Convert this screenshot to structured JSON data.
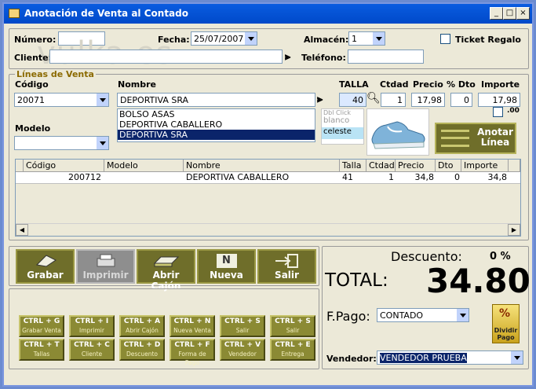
{
  "window": {
    "title": "Anotación de Venta al Contado"
  },
  "header": {
    "numero_label": "Número:",
    "numero_value": "",
    "fecha_label": "Fecha:",
    "fecha_value": "25/07/2007",
    "almacen_label": "Almacén:",
    "almacen_value": "1",
    "ticket_label": "Ticket Regalo",
    "cliente_label": "Cliente:",
    "cliente_value": "",
    "telefono_label": "Teléfono:",
    "telefono_value": "",
    "watermark": "vulka.es"
  },
  "lines": {
    "legend": "Líneas de Venta",
    "codigo_label": "Código",
    "codigo_value": "20071",
    "nombre_label": "Nombre",
    "nombre_value": "DEPORTIVA SRA",
    "talla_label": "TALLA",
    "talla_value": "40",
    "ctdad_label": "Ctdad",
    "ctdad_value": "1",
    "precio_label": "Precio",
    "precio_value": "17,98",
    "dto_label": "% Dto",
    "dto_value": "0",
    "importe_label": "Importe",
    "importe_value": "17,98",
    "modelo_label": "Modelo",
    "modelo_value": "",
    "name_options": [
      "BOLSO ASAS",
      "DEPORTIVA CABALLERO",
      "DEPORTIVA SRA"
    ],
    "color_hint": "Dbl Click",
    "color_options": [
      "blanco",
      "celeste"
    ],
    "extra_check_label": ".00",
    "anotar_label_1": "Anotar",
    "anotar_label_2": "Línea"
  },
  "grid": {
    "columns": [
      "Código",
      "Modelo",
      "Nombre",
      "Talla",
      "Ctdad.",
      "Precio",
      "Dto",
      "Importe"
    ],
    "rows": [
      {
        "codigo": "200712",
        "modelo": "",
        "nombre": "DEPORTIVA CABALLERO",
        "talla": "41",
        "ctdad": "1",
        "precio": "34,8",
        "dto": "0",
        "importe": "34,8"
      }
    ]
  },
  "toolbar": {
    "grabar": "Grabar",
    "imprimir": "Imprimir",
    "abrir": "Abrir Cajón",
    "nueva": "Nueva",
    "nueva_icon_letter": "N",
    "salir": "Salir"
  },
  "shortcuts": [
    {
      "key": "CTRL + G",
      "desc": "Grabar Venta"
    },
    {
      "key": "CTRL + I",
      "desc": "Imprimir"
    },
    {
      "key": "CTRL + A",
      "desc": "Abrir Cajón"
    },
    {
      "key": "CTRL + N",
      "desc": "Nueva Venta"
    },
    {
      "key": "CTRL + S",
      "desc": "Salir"
    },
    {
      "key": "CTRL + S",
      "desc": "Salir"
    },
    {
      "key": "CTRL + T",
      "desc": "Tallas"
    },
    {
      "key": "CTRL + C",
      "desc": "Cliente"
    },
    {
      "key": "CTRL + D",
      "desc": "Descuento"
    },
    {
      "key": "CTRL + F",
      "desc": "Forma de Pago"
    },
    {
      "key": "CTRL + V",
      "desc": "Vendedor"
    },
    {
      "key": "CTRL + E",
      "desc": "Entrega"
    }
  ],
  "totals": {
    "descuento_label": "Descuento:",
    "descuento_value": "0 %",
    "total_label": "TOTAL:",
    "total_value": "34.80",
    "fpago_label": "F.Pago:",
    "fpago_value": "CONTADO",
    "dividir_1": "Dividir",
    "dividir_2": "Pago",
    "vendedor_label": "Vendedor:",
    "vendedor_value": "VENDEDOR PRUEBA"
  }
}
